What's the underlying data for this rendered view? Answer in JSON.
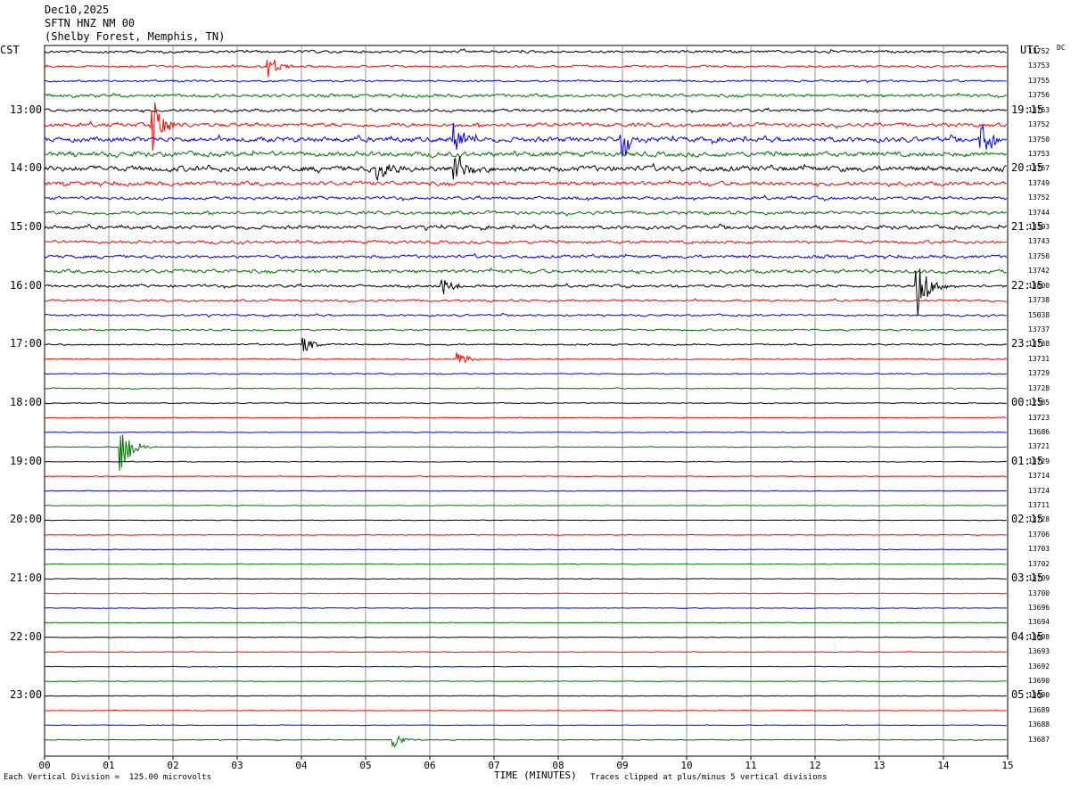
{
  "header": {
    "date": "Dec10,2025",
    "station": "SFTN HNZ NM 00",
    "location": "(Shelby Forest, Memphis, TN)"
  },
  "left_zone": "CST",
  "right_zone": "UTC",
  "corner_tag": "DC",
  "footer": {
    "scale_note": "Each Vertical Division =  125.00 microvolts",
    "xlabel": "TIME (MINUTES)",
    "clip_note": "Traces clipped at plus/minus 5 vertical divisions"
  },
  "colors": [
    "#000000",
    "#ff0000",
    "#0000ff",
    "#007000"
  ],
  "chart_data": {
    "type": "line",
    "title": "SFTN HNZ NM 00",
    "xlabel": "TIME (MINUTES)",
    "xlim": [
      0,
      15
    ],
    "x_ticks": [
      "00",
      "01",
      "02",
      "03",
      "04",
      "05",
      "06",
      "07",
      "08",
      "09",
      "10",
      "11",
      "12",
      "13",
      "14",
      "15"
    ],
    "trace_minutes": 15,
    "trace_count": 48,
    "cst_labels": [
      "13:00",
      "14:00",
      "15:00",
      "16:00",
      "17:00",
      "18:00",
      "19:00",
      "20:00",
      "21:00",
      "22:00",
      "23:00"
    ],
    "utc_labels": [
      "19:15",
      "20:15",
      "21:15",
      "22:15",
      "23:15",
      "00:15",
      "01:15",
      "02:15",
      "03:15",
      "04:15",
      "05:15"
    ],
    "trace_counts": [
      "13752",
      "13753",
      "13755",
      "13756",
      "13753",
      "13752",
      "13750",
      "13753",
      "13757",
      "13749",
      "13752",
      "13744",
      "13393",
      "13743",
      "13750",
      "13742",
      "13800",
      "13738",
      "15038",
      "13737",
      "13738",
      "13731",
      "13729",
      "13728",
      "12385",
      "13723",
      "13686",
      "13721",
      "13729",
      "13714",
      "13724",
      "13711",
      "13728",
      "13706",
      "13703",
      "13702",
      "13709",
      "13700",
      "13696",
      "13694",
      "13698",
      "13693",
      "13692",
      "13690",
      "13690",
      "13689",
      "13688",
      "13687"
    ],
    "trace_activity": [
      2.2,
      1.8,
      1.6,
      2.6,
      2.4,
      3.2,
      4.2,
      4.0,
      4.6,
      3.4,
      2.6,
      2.8,
      3.0,
      2.4,
      2.6,
      3.0,
      2.2,
      1.8,
      1.6,
      1.4,
      1.2,
      1.0,
      0.9,
      0.8,
      0.7,
      0.7,
      0.6,
      0.6,
      0.6,
      0.55,
      0.55,
      0.5,
      0.5,
      0.5,
      0.5,
      0.5,
      0.5,
      0.5,
      0.5,
      0.5,
      0.5,
      0.5,
      0.5,
      0.5,
      0.5,
      0.5,
      0.5,
      0.6
    ],
    "events": [
      {
        "trace": 1,
        "minute": 3.5,
        "amp": 14
      },
      {
        "trace": 5,
        "minute": 1.7,
        "amp": 30
      },
      {
        "trace": 6,
        "minute": 6.4,
        "amp": 25
      },
      {
        "trace": 8,
        "minute": 5.2,
        "amp": 18
      },
      {
        "trace": 8,
        "minute": 6.4,
        "amp": 22
      },
      {
        "trace": 6,
        "minute": 9.0,
        "amp": 24
      },
      {
        "trace": 6,
        "minute": 14.6,
        "amp": 30
      },
      {
        "trace": 16,
        "minute": 6.2,
        "amp": 10
      },
      {
        "trace": 16,
        "minute": 13.6,
        "amp": 40
      },
      {
        "trace": 20,
        "minute": 4.05,
        "amp": 9
      },
      {
        "trace": 21,
        "minute": 6.45,
        "amp": 10
      },
      {
        "trace": 27,
        "minute": 1.2,
        "amp": 30
      },
      {
        "trace": 47,
        "minute": 5.45,
        "amp": 8
      }
    ]
  }
}
